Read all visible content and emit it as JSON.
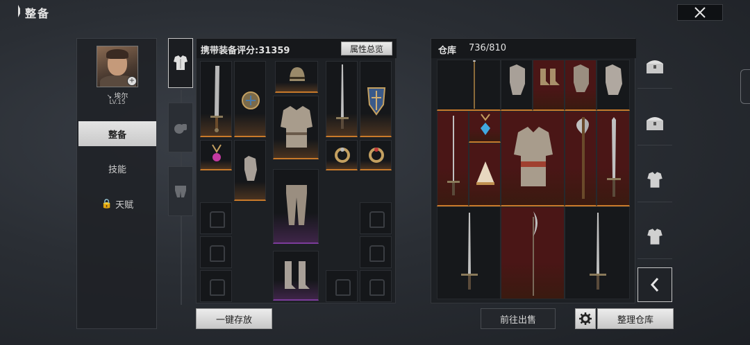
{
  "header": {
    "title": "整备"
  },
  "character": {
    "name": "埃尔",
    "level": "LV.15"
  },
  "nav": {
    "items": [
      {
        "label": "整备"
      },
      {
        "label": "技能"
      },
      {
        "label": "天赋"
      }
    ]
  },
  "equipment": {
    "score_label": "携带装备评分:31359",
    "overview_button": "属性总览",
    "store_all_button": "一键存放"
  },
  "warehouse": {
    "title": "仓库",
    "capacity": "736/810",
    "sell_button": "前往出售",
    "organize_button": "整理仓库"
  },
  "colors": {
    "rarity_orange": "#c97a2a",
    "rarity_purple": "#7c3c9c",
    "rarity_red_bg": "#4a1616"
  }
}
